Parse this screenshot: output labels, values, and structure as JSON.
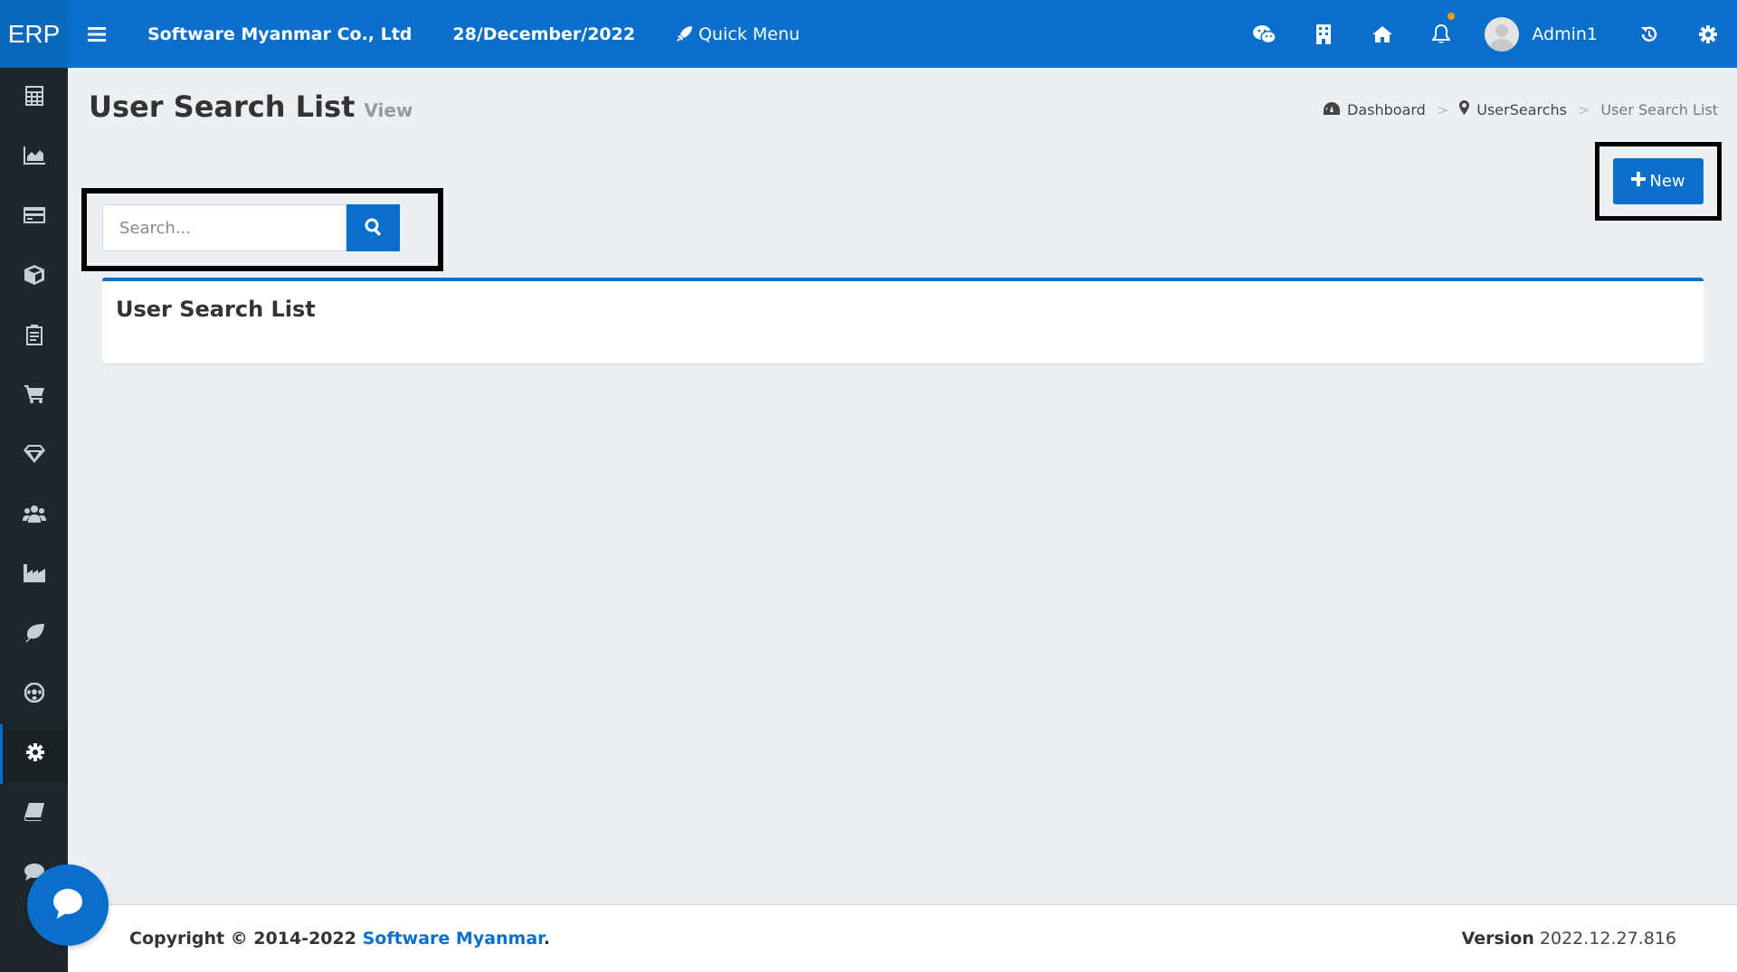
{
  "brand": {
    "logo": "ERP",
    "company": "Software Myanmar Co., Ltd",
    "date": "28/December/2022"
  },
  "nav": {
    "quick_menu": "Quick Menu",
    "icons": [
      "chat-icon",
      "building-icon",
      "home-icon",
      "bell-icon",
      "history-icon",
      "gear-icon"
    ],
    "user": "Admin1",
    "notification_dot_color": "#f39c12"
  },
  "sidebar": {
    "items": [
      {
        "icon": "calculator-icon"
      },
      {
        "icon": "area-chart-icon"
      },
      {
        "icon": "credit-card-icon"
      },
      {
        "icon": "cube-icon"
      },
      {
        "icon": "clipboard-icon"
      },
      {
        "icon": "cart-icon"
      },
      {
        "icon": "diamond-icon"
      },
      {
        "icon": "users-icon"
      },
      {
        "icon": "industry-icon"
      },
      {
        "icon": "leaf-icon"
      },
      {
        "icon": "soccer-ball-icon"
      },
      {
        "icon": "gear-icon",
        "active": true
      },
      {
        "icon": "book-icon"
      },
      {
        "icon": "comment-icon"
      }
    ]
  },
  "page": {
    "title": "User Search List",
    "subtitle": "View"
  },
  "breadcrumb": {
    "home": "Dashboard",
    "parent": "UserSearchs",
    "current": "User Search List",
    "separator": ">"
  },
  "toolbar": {
    "new_label": "New"
  },
  "search": {
    "placeholder": "Search...",
    "value": ""
  },
  "box": {
    "title": "User Search List"
  },
  "footer": {
    "copyright_prefix": "Copyright © 2014-2022",
    "company_link": "Software Myanmar",
    "period": ".",
    "version_label": "Version",
    "version_value": "2022.12.27.816"
  },
  "colors": {
    "primary": "#0a6fca",
    "sidebar": "#1e282c",
    "background": "#ecf0f5"
  }
}
